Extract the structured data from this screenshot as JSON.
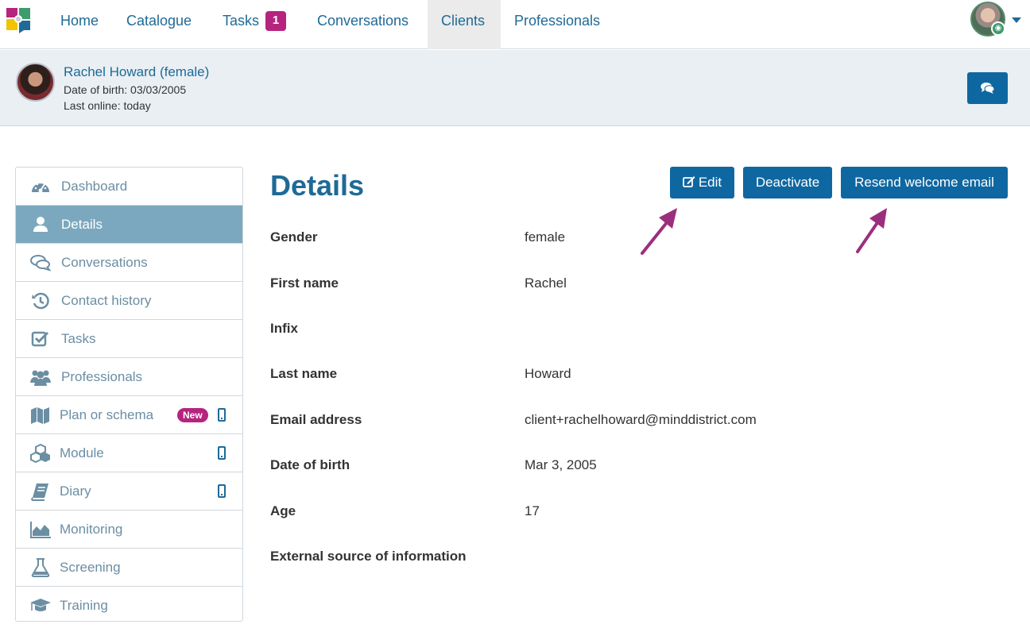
{
  "nav": {
    "items": [
      {
        "label": "Home"
      },
      {
        "label": "Catalogue"
      },
      {
        "label": "Tasks",
        "badge": "1"
      },
      {
        "label": "Conversations"
      },
      {
        "label": "Clients"
      },
      {
        "label": "Professionals"
      }
    ],
    "active": "Clients"
  },
  "client": {
    "name": "Rachel Howard (female)",
    "dob": "Date of birth: 03/03/2005",
    "online": "Last online: today"
  },
  "sidebar": {
    "items": [
      {
        "label": "Dashboard",
        "icon": "dashboard-icon"
      },
      {
        "label": "Details",
        "icon": "user-icon"
      },
      {
        "label": "Conversations",
        "icon": "comments-icon"
      },
      {
        "label": "Contact history",
        "icon": "history-icon"
      },
      {
        "label": "Tasks",
        "icon": "checkbox-icon"
      },
      {
        "label": "Professionals",
        "icon": "users-icon"
      },
      {
        "label": "Plan or schema",
        "icon": "map-icon",
        "pill": "New",
        "mobile": true
      },
      {
        "label": "Module",
        "icon": "cubes-icon",
        "mobile": true
      },
      {
        "label": "Diary",
        "icon": "book-icon",
        "mobile": true
      },
      {
        "label": "Monitoring",
        "icon": "area-chart-icon"
      },
      {
        "label": "Screening",
        "icon": "flask-icon"
      },
      {
        "label": "Training",
        "icon": "graduation-cap-icon"
      }
    ],
    "active": "Details"
  },
  "main": {
    "title": "Details",
    "buttons": {
      "edit": "Edit",
      "deactivate": "Deactivate",
      "resend": "Resend welcome email"
    },
    "fields": [
      {
        "label": "Gender",
        "value": "female"
      },
      {
        "label": "First name",
        "value": "Rachel"
      },
      {
        "label": "Infix",
        "value": ""
      },
      {
        "label": "Last name",
        "value": "Howard"
      },
      {
        "label": "Email address",
        "value": "client+rachelhoward@minddistrict.com"
      },
      {
        "label": "Date of birth",
        "value": "Mar 3, 2005"
      },
      {
        "label": "Age",
        "value": "17"
      },
      {
        "label": "External source of information",
        "value": ""
      }
    ]
  },
  "colors": {
    "brand": "#0f67a1",
    "link": "#1f6a96",
    "active_sidebar": "#7ba8be",
    "badge": "#b5247e",
    "annotation_arrow": "#9b2f7e"
  }
}
